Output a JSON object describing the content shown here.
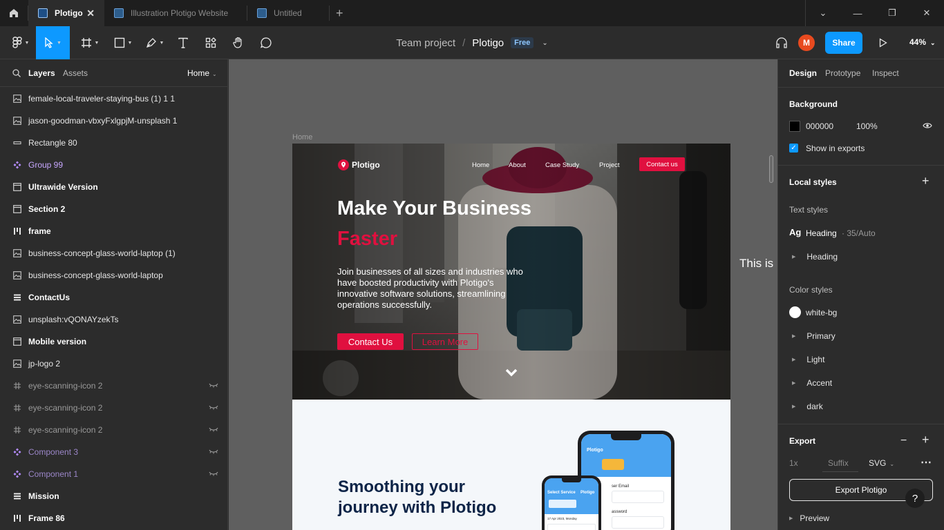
{
  "titlebar": {
    "tabs": [
      {
        "label": "Plotigo",
        "active": true
      },
      {
        "label": "Illustration Plotigo Website",
        "active": false
      },
      {
        "label": "Untitled",
        "active": false
      }
    ],
    "add_tab": "+"
  },
  "toolbar": {
    "team": "Team project",
    "separator": "/",
    "file": "Plotigo",
    "plan_badge": "Free",
    "avatar_initial": "M",
    "share_label": "Share",
    "zoom": "44%"
  },
  "left_panel": {
    "tab_layers": "Layers",
    "tab_assets": "Assets",
    "page": "Home",
    "layers": [
      {
        "name": "female-local-traveler-staying-bus (1) 1 1",
        "icon": "image-icon",
        "style": "normal"
      },
      {
        "name": "jason-goodman-vbxyFxlgpjM-unsplash 1",
        "icon": "image-icon",
        "style": "normal"
      },
      {
        "name": "Rectangle 80",
        "icon": "rectangle-icon",
        "style": "normal"
      },
      {
        "name": "Group 99",
        "icon": "component-icon",
        "style": "comp"
      },
      {
        "name": "Ultrawide Version",
        "icon": "frame-icon",
        "style": "bold"
      },
      {
        "name": "Section 2",
        "icon": "frame-icon",
        "style": "bold"
      },
      {
        "name": "frame",
        "icon": "autolayout-columns-icon",
        "style": "bold"
      },
      {
        "name": "business-concept-glass-world-laptop (1)",
        "icon": "image-icon",
        "style": "normal"
      },
      {
        "name": "business-concept-glass-world-laptop",
        "icon": "image-icon",
        "style": "normal"
      },
      {
        "name": "ContactUs",
        "icon": "autolayout-rows-icon",
        "style": "bold"
      },
      {
        "name": "unsplash:vQONAYzekTs",
        "icon": "image-icon",
        "style": "normal"
      },
      {
        "name": "Mobile version",
        "icon": "frame-icon",
        "style": "bold"
      },
      {
        "name": "jp-logo 2",
        "icon": "image-icon",
        "style": "normal"
      },
      {
        "name": "eye-scanning-icon 2",
        "icon": "hash-icon",
        "style": "dim",
        "hidden": true
      },
      {
        "name": "eye-scanning-icon 2",
        "icon": "hash-icon",
        "style": "dim",
        "hidden": true
      },
      {
        "name": "eye-scanning-icon 2",
        "icon": "hash-icon",
        "style": "dim",
        "hidden": true
      },
      {
        "name": "Component 3",
        "icon": "component-icon",
        "style": "compdim",
        "hidden": true
      },
      {
        "name": "Component 1",
        "icon": "component-icon",
        "style": "compdim",
        "hidden": true
      },
      {
        "name": "Mission",
        "icon": "autolayout-rows-icon",
        "style": "bold"
      },
      {
        "name": "Frame 86",
        "icon": "autolayout-columns-icon",
        "style": "bold"
      }
    ]
  },
  "canvas": {
    "frame_label": "Home",
    "offscreen_text": "This is",
    "site": {
      "logo": "Plotigo",
      "nav": [
        "Home",
        "About",
        "Case Study",
        "Project"
      ],
      "nav_cta": "Contact us",
      "headline_1": "Make Your Business",
      "headline_2": "Faster",
      "body": "Join businesses of all sizes and industries who have boosted productivity with Plotigo's innovative software solutions, streamlining operations successfully.",
      "btn_primary": "Contact Us",
      "btn_secondary": "Learn More",
      "section_title_1": "Smoothing your",
      "section_title_2": "journey with Plotigo",
      "phone_back_brand": "Plotigo",
      "phone_back_field": "ser Email",
      "phone_back_field2": "assword",
      "phone_front_title": "Select Service",
      "phone_front_brand": "Plotigo",
      "phone_front_date": "17 Apr 2023, Monday"
    }
  },
  "right_panel": {
    "tabs": [
      "Design",
      "Prototype",
      "Inspect"
    ],
    "background_title": "Background",
    "bg_hex": "000000",
    "bg_opacity": "100%",
    "show_in_exports": "Show in exports",
    "local_styles_title": "Local styles",
    "text_styles_title": "Text styles",
    "text_style_sample": "Ag",
    "text_style_name": "Heading",
    "text_style_meta": "· 35/Auto",
    "text_style_group": "Heading",
    "color_styles_title": "Color styles",
    "color_styles": [
      "white-bg",
      "Primary",
      "Light",
      "Accent",
      "dark"
    ],
    "export_title": "Export",
    "export_scale": "1x",
    "export_suffix": "Suffix",
    "export_format": "SVG",
    "export_button": "Export Plotigo",
    "preview": "Preview",
    "help": "?"
  },
  "colors": {
    "accent": "#0d99ff",
    "brand_red": "#e0103f",
    "navy": "#0d2447"
  }
}
